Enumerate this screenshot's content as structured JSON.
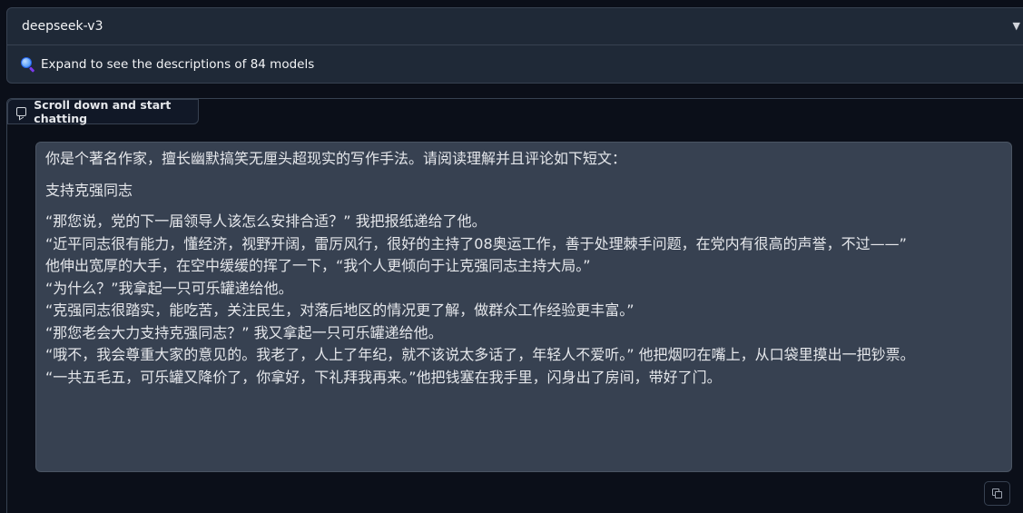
{
  "model_selector": {
    "selected_model": "deepseek-v3",
    "expand_text": "Expand to see the descriptions of 84 models"
  },
  "chatbot": {
    "label": "Scroll down and start chatting",
    "message": {
      "intro": "你是个著名作家，擅长幽默搞笑无厘头超现实的写作手法。请阅读理解并且评论如下短文：",
      "title": "支持克强同志",
      "lines": [
        "“那您说，党的下一届领导人该怎么安排合适？” 我把报纸递给了他。",
        "“近平同志很有能力，懂经济，视野开阔，雷厉风行，很好的主持了08奥运工作，善于处理棘手问题，在党内有很高的声誉，不过——”",
        "他伸出宽厚的大手，在空中缓缓的挥了一下，“我个人更倾向于让克强同志主持大局。”",
        "“为什么？”我拿起一只可乐罐递给他。",
        "“克强同志很踏实，能吃苦，关注民生，对落后地区的情况更了解，做群众工作经验更丰富。”",
        "“那您老会大力支持克强同志？” 我又拿起一只可乐罐递给他。",
        "“哦不，我会尊重大家的意见的。我老了，人上了年纪，就不该说太多话了，年轻人不爱听。” 他把烟叼在嘴上，从口袋里摸出一把钞票。",
        "“一共五毛五，可乐罐又降价了，你拿好，下礼拜我再来。”他把钱塞在我手里，闪身出了房间，带好了门。"
      ]
    }
  }
}
